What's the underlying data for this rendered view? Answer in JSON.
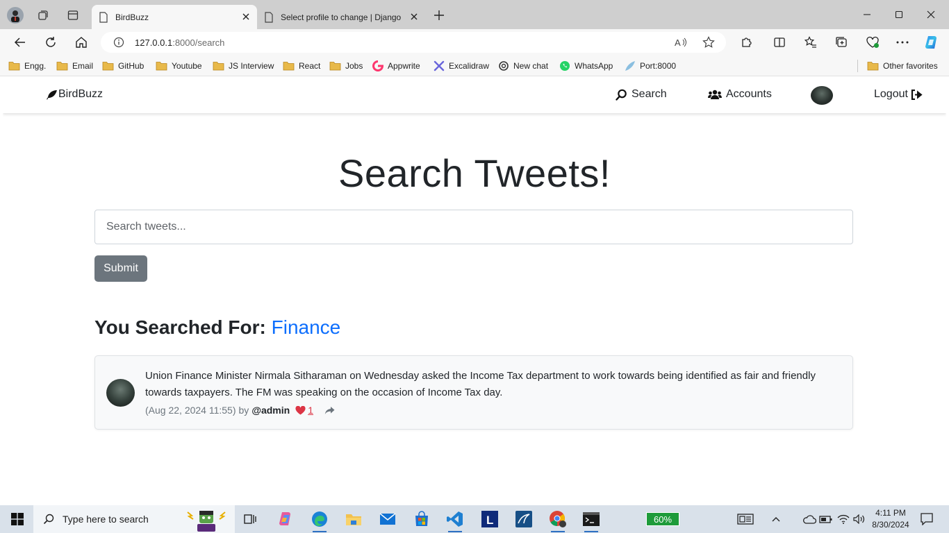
{
  "browser": {
    "tabs": [
      {
        "label": "BirdBuzz",
        "active": true
      },
      {
        "label": "Select profile to change | Django site admin",
        "active": false
      }
    ],
    "url_host": "127.0.0.1",
    "url_rest": ":8000/search",
    "bookmarks": [
      "Engg.",
      "Email",
      "GitHub",
      "Youtube",
      "JS Interview",
      "React",
      "Jobs",
      "Appwrite",
      "Excalidraw",
      "New chat",
      "WhatsApp",
      "Port:8000"
    ],
    "other_favorites": "Other favorites"
  },
  "navbar": {
    "brand": "BirdBuzz",
    "search": "Search",
    "accounts": "Accounts",
    "logout": "Logout"
  },
  "page": {
    "title": "Search Tweets!",
    "search_placeholder": "Search tweets...",
    "submit_label": "Submit",
    "searched_label": "You Searched For:",
    "searched_term": "Finance"
  },
  "tweet": {
    "text": "Union Finance Minister Nirmala Sitharaman on Wednesday asked the Income Tax department to work towards being identified as fair and friendly towards taxpayers. The FM was speaking on the occasion of Income Tax day.",
    "date": "(Aug 22, 2024 11:55)",
    "by": "by",
    "author": "@admin",
    "likes": "1"
  },
  "taskbar": {
    "search_placeholder": "Type here to search",
    "battery": "60%",
    "time": "4:11 PM",
    "date": "8/30/2024"
  },
  "colors": {
    "accent": "#0d6efd",
    "submit_bg": "#6c757d",
    "like": "#dc3545",
    "folder": "#e8b94a"
  }
}
